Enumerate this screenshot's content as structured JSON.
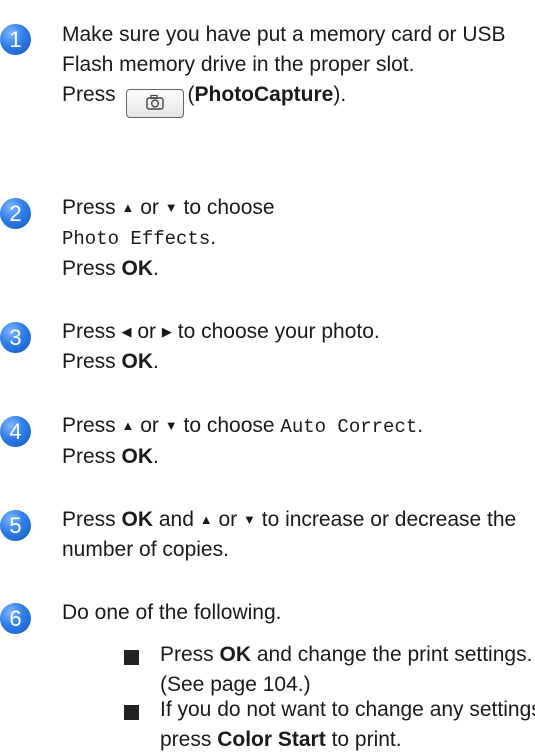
{
  "steps": [
    {
      "number": "1",
      "line1": "Make sure you have put a memory card or USB Flash memory drive in the proper slot.",
      "press": "Press",
      "button_name": "PhotoCapture",
      "punct_open": "(",
      "punct_close": ")."
    },
    {
      "number": "2",
      "pre": "Press",
      "up": "▲",
      "or": "or",
      "down": "▼",
      "mid": "to choose",
      "item": "Photo Effects",
      "post_period": ".",
      "press": "Press",
      "ok": "OK",
      "period": "."
    },
    {
      "number": "3",
      "pre": "Press",
      "left": "◀",
      "or": "or",
      "right": "▶",
      "mid": "to choose your photo.",
      "press": "Press",
      "ok": "OK",
      "period": "."
    },
    {
      "number": "4",
      "pre": "Press",
      "up": "▲",
      "or": "or",
      "down": "▼",
      "mid": "to choose",
      "item": "Auto Correct",
      "post_period": ".",
      "press": "Press",
      "ok": "OK",
      "period": "."
    },
    {
      "number": "5",
      "pre": "Press",
      "ok": "OK",
      "and": "and",
      "up": "▲",
      "or": "or",
      "down": "▼",
      "rest": "to increase or decrease the number of copies."
    },
    {
      "number": "6",
      "text": "Do one of the following.",
      "bullets": [
        {
          "pre": "Press",
          "bold": "OK",
          "post": "and change the print settings. (See page 104.)"
        },
        {
          "pre": "If you do not want to change any settings, press",
          "bold": "Color Start",
          "post": "to print."
        }
      ]
    }
  ],
  "icons": {
    "camera": "camera-icon"
  },
  "colors": {
    "step_badge": "#2f7de6"
  }
}
